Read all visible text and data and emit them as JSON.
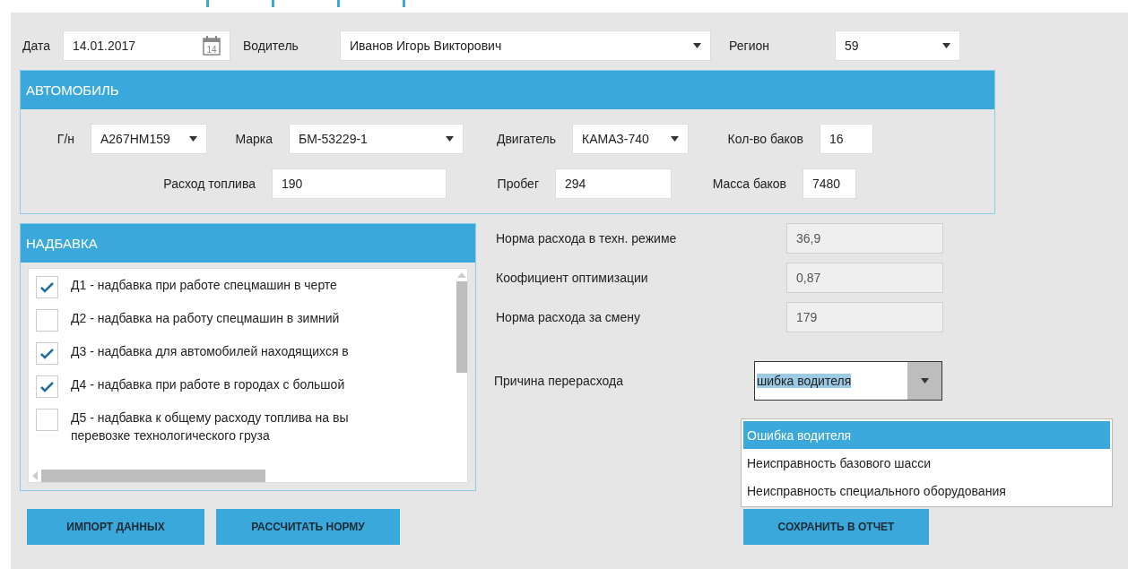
{
  "header": {
    "date_label": "Дата",
    "date_value": "14.01.2017",
    "calendar_day": "14",
    "driver_label": "Водитель",
    "driver_value": "Иванов Игорь Викторович",
    "region_label": "Регион",
    "region_value": "59"
  },
  "car": {
    "title": "АВТОМОБИЛЬ",
    "row1": [
      {
        "label": "Г/н",
        "value": "А267НМ159",
        "kind": "combo"
      },
      {
        "label": "Марка",
        "value": "БМ-53229-1",
        "kind": "combo"
      },
      {
        "label": "Двигатель",
        "value": "КАМАЗ-740",
        "kind": "combo"
      },
      {
        "label": "Кол-во баков",
        "value": "16",
        "kind": "text"
      }
    ],
    "row2": [
      {
        "label": "Расход топлива",
        "value": "190",
        "kind": "text"
      },
      {
        "label": "Пробег",
        "value": "294",
        "kind": "text"
      },
      {
        "label": "Масса баков",
        "value": "7480",
        "kind": "text"
      }
    ]
  },
  "surcharge": {
    "title": "НАДБАВКА",
    "items": [
      {
        "lines": [
          "Д1 - надбавка при работе спецмашин в черте"
        ],
        "checked": true
      },
      {
        "lines": [
          "Д2 - надбавка на работу спецмашин в зимний"
        ],
        "checked": false
      },
      {
        "lines": [
          "Д3 - надбавка для автомобилей находящихся в"
        ],
        "checked": true
      },
      {
        "lines": [
          "Д4 - надбавка при работе в городах с большой"
        ],
        "checked": true
      },
      {
        "lines": [
          "Д5 - надбавка к общему расходу топлива на вы",
          "перевозке технологического груза"
        ],
        "checked": false
      }
    ]
  },
  "norms": [
    {
      "label": "Норма расхода в техн. режиме",
      "value": "36,9"
    },
    {
      "label": "Коофициент оптимизации",
      "value": "0,87"
    },
    {
      "label": "Норма расхода за смену",
      "value": "179"
    }
  ],
  "overspend": {
    "label": "Причина перерасхода",
    "value": "шибка водителя",
    "expanded": true,
    "options": [
      {
        "label": "Ошибка водителя",
        "selected": true
      },
      {
        "label": "Неисправность базового шасси",
        "selected": false
      },
      {
        "label": "Неисправность специального оборудования",
        "selected": false
      }
    ]
  },
  "buttons": {
    "left": [
      "ИМПОРТ ДАННЫХ",
      "РАССЧИТАТЬ НОРМУ"
    ],
    "right": "СОХРАНИТЬ В ОТЧЕТ"
  }
}
